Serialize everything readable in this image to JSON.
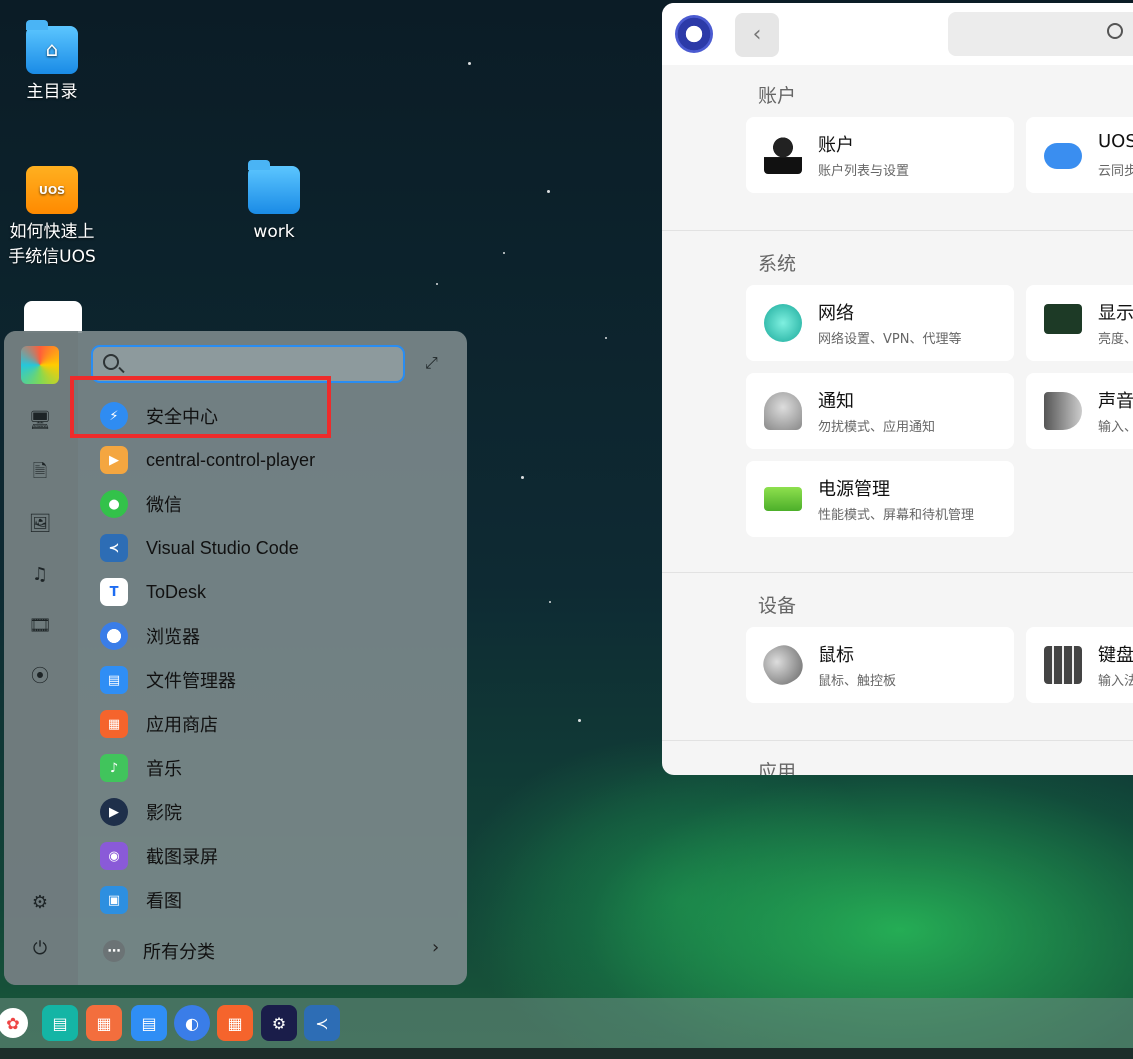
{
  "desktop": {
    "icons": [
      {
        "label": "主目录"
      },
      {
        "label": "如何快速上手统信UOS",
        "line1": "如何快速上",
        "line2": "手统信UOS",
        "badge": "UOS"
      },
      {
        "label": "work"
      }
    ]
  },
  "launcher": {
    "search_placeholder": "",
    "apps": [
      {
        "label": "安全中心",
        "color": "#2f8cf2"
      },
      {
        "label": "central-control-player",
        "color": "#f4a640"
      },
      {
        "label": "微信",
        "color": "#33c24a"
      },
      {
        "label": "Visual Studio Code",
        "color": "#2d6db5"
      },
      {
        "label": "ToDesk",
        "color": "#1d6cf2"
      },
      {
        "label": "浏览器",
        "color": "#3a7de8"
      },
      {
        "label": "文件管理器",
        "color": "#2f8ef5"
      },
      {
        "label": "应用商店",
        "color": "#f5642c"
      },
      {
        "label": "音乐",
        "color": "#41c45c"
      },
      {
        "label": "影院",
        "color": "#1e2f4a"
      },
      {
        "label": "截图录屏",
        "color": "#8a5ad8"
      },
      {
        "label": "看图",
        "color": "#2d8fe0"
      }
    ],
    "all_categories": "所有分类"
  },
  "settings": {
    "sections": [
      {
        "title": "账户"
      },
      {
        "title": "系统"
      },
      {
        "title": "设备"
      },
      {
        "title": "应用"
      }
    ],
    "cards": {
      "account": {
        "title": "账户",
        "subtitle": "账户列表与设置"
      },
      "uos_cloud": {
        "title": "UOS",
        "subtitle": "云同步"
      },
      "network": {
        "title": "网络",
        "subtitle": "网络设置、VPN、代理等"
      },
      "display": {
        "title": "显示",
        "subtitle": "亮度、"
      },
      "notification": {
        "title": "通知",
        "subtitle": "勿扰模式、应用通知"
      },
      "sound": {
        "title": "声音",
        "subtitle": "输入、"
      },
      "power": {
        "title": "电源管理",
        "subtitle": "性能模式、屏幕和待机管理"
      },
      "mouse": {
        "title": "鼠标",
        "subtitle": "鼠标、触控板"
      },
      "keyboard": {
        "title": "键盘",
        "subtitle": "输入法"
      }
    }
  },
  "colors": {
    "accent": "#2a8df2",
    "highlight_box": "#ee2b2b"
  }
}
